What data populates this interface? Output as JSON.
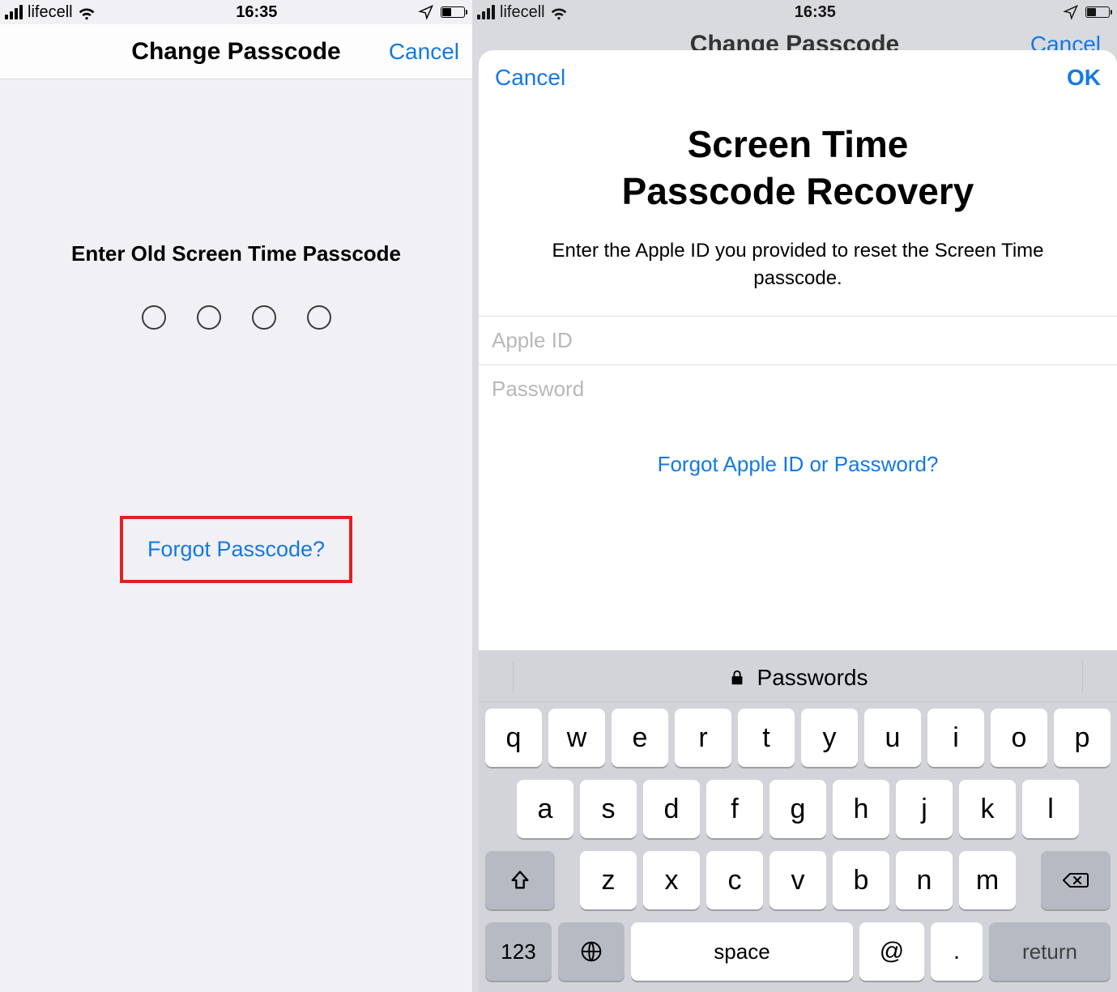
{
  "status": {
    "carrier": "lifecell",
    "time": "16:35"
  },
  "left": {
    "nav_title": "Change Passcode",
    "nav_cancel": "Cancel",
    "prompt": "Enter Old Screen Time Passcode",
    "forgot": "Forgot Passcode?"
  },
  "right": {
    "dim_title": "Change Passcode",
    "dim_cancel": "Cancel",
    "sheet_cancel": "Cancel",
    "sheet_ok": "OK",
    "title_line1": "Screen Time",
    "title_line2": "Passcode Recovery",
    "subtitle": "Enter the Apple ID you provided to reset the Screen Time passcode.",
    "apple_id_placeholder": "Apple ID",
    "password_placeholder": "Password",
    "forgot_apple": "Forgot Apple ID or Password?"
  },
  "keyboard": {
    "suggest": "Passwords",
    "row1": [
      "q",
      "w",
      "e",
      "r",
      "t",
      "y",
      "u",
      "i",
      "o",
      "p"
    ],
    "row2": [
      "a",
      "s",
      "d",
      "f",
      "g",
      "h",
      "j",
      "k",
      "l"
    ],
    "row3": [
      "z",
      "x",
      "c",
      "v",
      "b",
      "n",
      "m"
    ],
    "k123": "123",
    "space": "space",
    "at": "@",
    "dot": ".",
    "ret": "return"
  }
}
